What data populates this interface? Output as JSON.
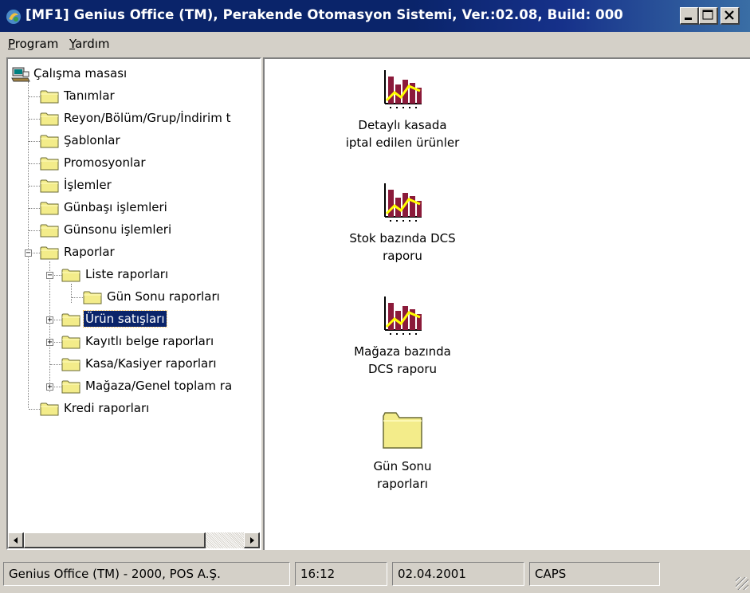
{
  "window": {
    "title": "[MF1] Genius Office (TM), Perakende Otomasyon Sistemi, Ver.:02.08, Build: 000"
  },
  "menu": {
    "items": [
      {
        "label": "Program",
        "access_key": "P"
      },
      {
        "label": "Yardım",
        "access_key": "Y"
      }
    ]
  },
  "tree": {
    "root": "Çalışma masası",
    "nodes": [
      {
        "label": "Tanımlar"
      },
      {
        "label": "Reyon/Bölüm/Grup/İndirim t"
      },
      {
        "label": "Şablonlar"
      },
      {
        "label": "Promosyonlar"
      },
      {
        "label": "İşlemler"
      },
      {
        "label": "Günbaşı işlemleri"
      },
      {
        "label": "Günsonu işlemleri"
      },
      {
        "label": "Raporlar",
        "expanded": true
      },
      {
        "label": "Liste raporları",
        "expanded": true
      },
      {
        "label": "Gün Sonu raporları"
      },
      {
        "label": "Ürün satışları",
        "selected": true,
        "collapsed": true
      },
      {
        "label": "Kayıtlı belge raporları",
        "collapsed": true
      },
      {
        "label": "Kasa/Kasiyer raporları"
      },
      {
        "label": "Mağaza/Genel toplam ra",
        "collapsed": true
      },
      {
        "label": "Kredi raporları"
      }
    ]
  },
  "content": {
    "items": [
      {
        "line1": "Detaylı kasada",
        "line2": "iptal edilen ürünler",
        "icon": "report-chart-icon"
      },
      {
        "line1": "Stok bazında DCS",
        "line2": "raporu",
        "icon": "report-chart-icon"
      },
      {
        "line1": "Mağaza bazında",
        "line2": "DCS raporu",
        "icon": "report-chart-icon"
      },
      {
        "line1": "Gün Sonu",
        "line2": "raporları",
        "icon": "folder-icon"
      }
    ]
  },
  "status": {
    "app": "Genius Office (TM) - 2000, POS A.Ş.",
    "time": "16:12",
    "date": "02.04.2001",
    "caps": "CAPS"
  },
  "colors": {
    "title_bar": "#0a246a",
    "selection": "#0a246a",
    "folder": "#f3ec8a",
    "chart_bar": "#8b1a3a",
    "chart_line": "#ffff00"
  }
}
